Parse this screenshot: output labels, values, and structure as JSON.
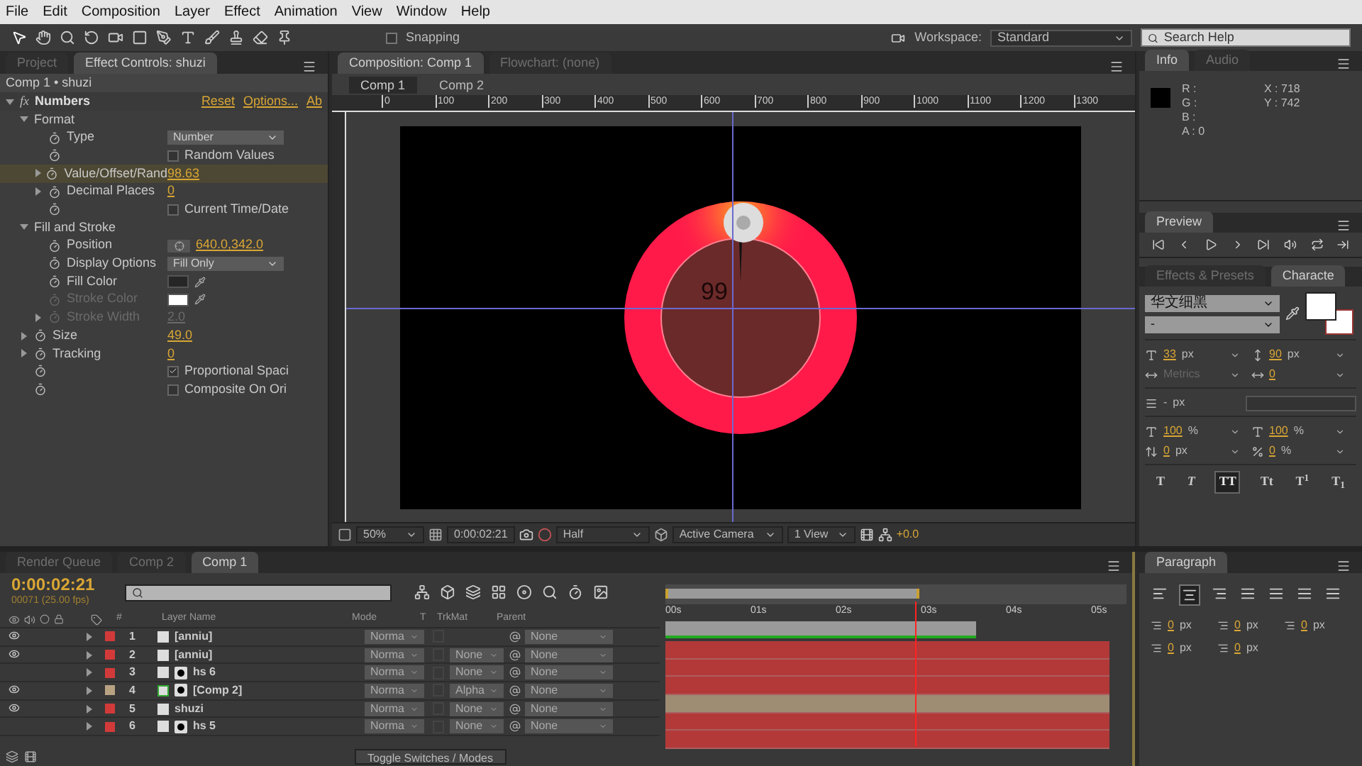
{
  "menu": [
    "File",
    "Edit",
    "Composition",
    "Layer",
    "Effect",
    "Animation",
    "View",
    "Window",
    "Help"
  ],
  "toolbar": {
    "snapping": {
      "label": "Snapping",
      "checked": false
    },
    "workspace_label": "Workspace:",
    "workspace": "Standard",
    "search_placeholder": "Search Help"
  },
  "effect_panel": {
    "tabs": [
      {
        "label": "Project",
        "selected": false
      },
      {
        "label": "Effect Controls: shuzi",
        "selected": true
      }
    ],
    "breadcrumb": "Comp 1 • shuzi",
    "effect": {
      "badge": "fx",
      "name": "Numbers",
      "expanded": true,
      "links": [
        "Reset",
        "Options...",
        "Ab"
      ]
    },
    "properties": [
      {
        "kind": "group",
        "label": "Format",
        "expanded": true,
        "selected": false,
        "children": [
          {
            "kind": "dropdown",
            "label": "Type",
            "value": "Number",
            "selected": false,
            "disabled": false
          },
          {
            "kind": "checkbox",
            "option": "Random Values",
            "checked": false,
            "selected": false,
            "disabled": false
          },
          {
            "kind": "value",
            "label": "Value/Offset/Rand",
            "value": "98.63",
            "expandable": true,
            "selected": true,
            "disabled": false
          },
          {
            "kind": "value",
            "label": "Decimal Places",
            "value": "0",
            "expandable": true,
            "selected": false,
            "disabled": false
          },
          {
            "kind": "checkbox",
            "option": "Current Time/Date",
            "checked": false,
            "selected": false,
            "disabled": false
          }
        ]
      },
      {
        "kind": "group",
        "label": "Fill and Stroke",
        "expanded": true,
        "selected": false,
        "children": [
          {
            "kind": "point",
            "label": "Position",
            "value": "640.0,342.0",
            "selected": false,
            "disabled": false
          },
          {
            "kind": "dropdown",
            "label": "Display Options",
            "value": "Fill Only",
            "selected": false,
            "disabled": false
          },
          {
            "kind": "color",
            "label": "Fill Color",
            "color": "#262626",
            "selected": false,
            "disabled": false
          },
          {
            "kind": "color",
            "label": "Stroke Color",
            "color": "#ffffff",
            "selected": false,
            "disabled": true
          },
          {
            "kind": "value",
            "label": "Stroke Width",
            "value": "2.0",
            "expandable": true,
            "selected": false,
            "disabled": true
          }
        ]
      },
      {
        "kind": "value",
        "label": "Size",
        "value": "49.0",
        "expandable": true,
        "selected": false,
        "disabled": false
      },
      {
        "kind": "value",
        "label": "Tracking",
        "value": "0",
        "expandable": true,
        "selected": false,
        "disabled": false
      },
      {
        "kind": "checkbox",
        "option": "Proportional Spaci",
        "checked": true,
        "selected": false,
        "disabled": false
      },
      {
        "kind": "checkbox",
        "option": "Composite On Ori",
        "checked": false,
        "selected": false,
        "disabled": false
      }
    ]
  },
  "composition_panel": {
    "tabs": [
      {
        "label": "Composition: Comp 1",
        "selected": true
      },
      {
        "label": "Flowchart: (none)",
        "selected": false
      }
    ],
    "breadcrumbs": [
      {
        "label": "Comp 1",
        "selected": true
      },
      {
        "label": "Comp 2",
        "selected": false
      }
    ],
    "ruler_ticks": [
      "0",
      "100",
      "200",
      "300",
      "400",
      "500",
      "600",
      "700",
      "800",
      "900",
      "1000",
      "1100",
      "1200",
      "1300"
    ],
    "overlay_text": "99",
    "footer": {
      "zoom": "50%",
      "timecode": "0:00:02:21",
      "resolution": "Half",
      "camera": "Active Camera",
      "views": "1 View",
      "exposure": "+0.0"
    }
  },
  "info_panel": {
    "tabs": [
      {
        "label": "Info",
        "selected": true
      },
      {
        "label": "Audio",
        "selected": false
      }
    ],
    "channels": [
      "R :",
      "G :",
      "B :",
      "A : 0"
    ],
    "coords": [
      "X : 718",
      "Y : 742"
    ]
  },
  "preview_panel": {
    "tabs": [
      {
        "label": "Preview",
        "selected": true
      }
    ]
  },
  "character_panel": {
    "tabs": [
      {
        "label": "Effects & Presets",
        "selected": false
      },
      {
        "label": "Characte",
        "selected": true
      }
    ],
    "font": "华文细黑",
    "style": "-",
    "fields": [
      {
        "kind": "size",
        "value": "33",
        "unit": "px",
        "disabled": false
      },
      {
        "kind": "leading",
        "value": "90",
        "unit": "px",
        "disabled": false
      },
      {
        "kind": "kerning",
        "value": "Metrics",
        "disabled": true
      },
      {
        "kind": "tracking",
        "value": "0",
        "disabled": false
      },
      {
        "kind": "vscale",
        "value": "100",
        "unit": "%",
        "disabled": false
      },
      {
        "kind": "hscale",
        "value": "100",
        "unit": "%",
        "disabled": false
      },
      {
        "kind": "baseline",
        "value": "0",
        "unit": "px",
        "disabled": false
      },
      {
        "kind": "tsume",
        "value": "0",
        "unit": "%",
        "disabled": false
      }
    ],
    "stroke": {
      "value": "-",
      "unit": "px"
    },
    "styles": [
      {
        "label": "T",
        "selected": false
      },
      {
        "label": "*T*",
        "selected": false
      },
      {
        "label": "TT",
        "selected": true
      },
      {
        "label": "Tt",
        "selected": false
      },
      {
        "label": "T$^{1}$",
        "selected": false
      },
      {
        "label": "T$_{1}$",
        "selected": false
      }
    ]
  },
  "timeline": {
    "tabs": [
      {
        "label": "Render Queue",
        "selected": false
      },
      {
        "label": "Comp 2",
        "selected": false
      },
      {
        "label": "Comp 1",
        "selected": true
      }
    ],
    "timecode": "0:00:02:21",
    "frames": "00071 (25.00 fps)",
    "columns": [
      "#",
      "Layer Name",
      "Mode",
      "T",
      "TrkMat",
      "Parent"
    ],
    "rows": [
      {
        "number": "1",
        "name": "[anniu]",
        "kind": "solid",
        "visible": true,
        "color": "#d23a3a",
        "mode": "Norma",
        "trkmat": null,
        "parent": "None"
      },
      {
        "number": "2",
        "name": "[anniu]",
        "kind": "solid",
        "visible": true,
        "color": "#d23a3a",
        "mode": "Norma",
        "trkmat": "None",
        "parent": "None"
      },
      {
        "number": "3",
        "name": "hs 6",
        "kind": "shape",
        "visible": false,
        "color": "#d23a3a",
        "mode": "Norma",
        "trkmat": "None",
        "parent": "None"
      },
      {
        "number": "4",
        "name": "[Comp 2]",
        "kind": "comp",
        "visible": true,
        "color": "#b8a282",
        "mode": "Norma",
        "trkmat": "Alpha",
        "parent": "None"
      },
      {
        "number": "5",
        "name": "shuzi",
        "kind": "solid",
        "visible": true,
        "color": "#d23a3a",
        "mode": "Norma",
        "trkmat": "None",
        "parent": "None"
      },
      {
        "number": "6",
        "name": "hs 5",
        "kind": "shape",
        "visible": false,
        "color": "#d23a3a",
        "mode": "Norma",
        "trkmat": "None",
        "parent": "None"
      }
    ],
    "time_ticks": [
      "00s",
      "01s",
      "02s",
      "03s",
      "04s",
      "05s"
    ],
    "playhead": {
      "level": 0.54
    },
    "work_area": {
      "level": 0.55
    },
    "toggle_label": "Toggle Switches / Modes"
  },
  "paragraph_panel": {
    "tabs": [
      {
        "label": "Paragraph",
        "selected": true
      }
    ],
    "alignments": [
      {
        "kind": "left",
        "selected": false
      },
      {
        "kind": "center",
        "selected": true
      },
      {
        "kind": "right",
        "selected": false
      },
      {
        "kind": "justify",
        "selected": false
      },
      {
        "kind": "justify",
        "selected": false
      },
      {
        "kind": "justify",
        "selected": false
      },
      {
        "kind": "justify",
        "selected": false
      }
    ],
    "indents": [
      {
        "value": "0",
        "unit": "px"
      },
      {
        "value": "0",
        "unit": "px"
      },
      {
        "value": "0",
        "unit": "px"
      },
      {
        "value": "0",
        "unit": "px"
      },
      {
        "value": "0",
        "unit": "px"
      }
    ]
  }
}
